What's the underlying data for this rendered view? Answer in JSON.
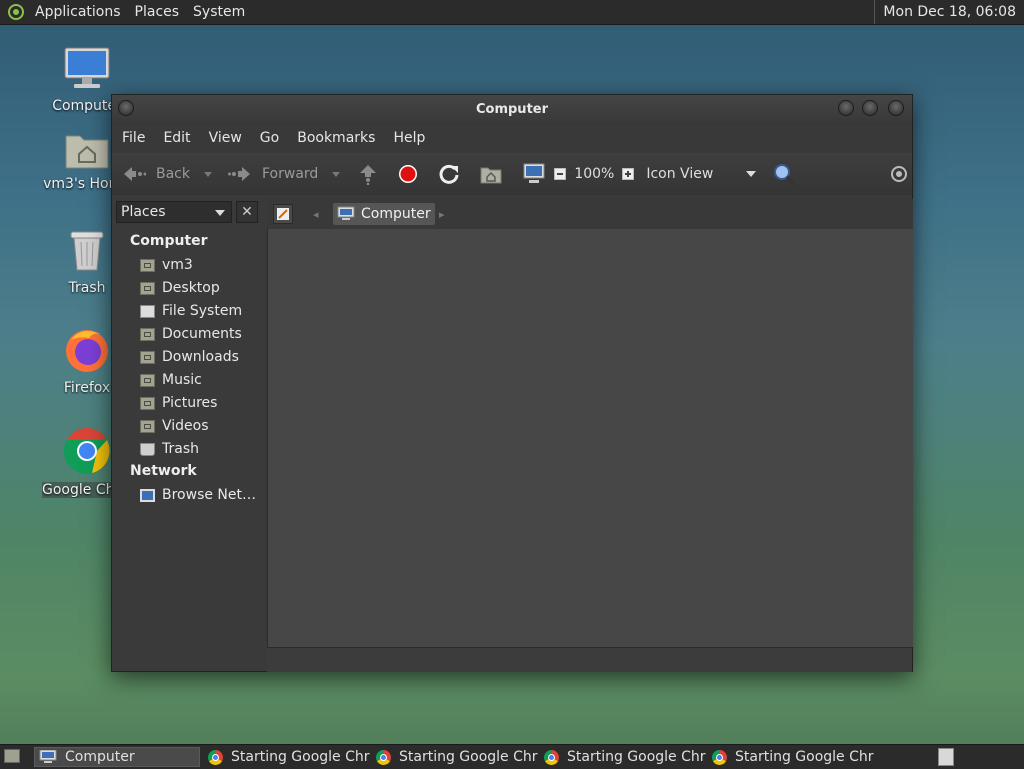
{
  "top_panel": {
    "menus": [
      "Applications",
      "Places",
      "System"
    ],
    "clock": "Mon Dec 18, 06:08"
  },
  "desktop": {
    "icons": [
      "Computer",
      "vm3's Home",
      "Trash",
      "Firefox",
      "Google Chrome"
    ]
  },
  "window": {
    "title": "Computer",
    "menus": [
      "File",
      "Edit",
      "View",
      "Go",
      "Bookmarks",
      "Help"
    ],
    "toolbar": {
      "back": "Back",
      "forward": "Forward",
      "zoom": "100%",
      "view_mode": "Icon View"
    },
    "sidebar": {
      "selector": "Places",
      "sections": [
        {
          "heading": "Computer",
          "items": [
            "vm3",
            "Desktop",
            "File System",
            "Documents",
            "Downloads",
            "Music",
            "Pictures",
            "Videos",
            "Trash"
          ]
        },
        {
          "heading": "Network",
          "items": [
            "Browse Net…"
          ]
        }
      ]
    },
    "breadcrumb": "Computer"
  },
  "taskbar": {
    "tasks": [
      "Computer",
      "Starting Google Chr…",
      "Starting Google Chr…",
      "Starting Google Chr…",
      "Starting Google Chr…"
    ]
  },
  "colors": {
    "stop_red": "#e01010",
    "panel_bg": "#2b2b2b",
    "window_bg": "#3a3a3a"
  }
}
